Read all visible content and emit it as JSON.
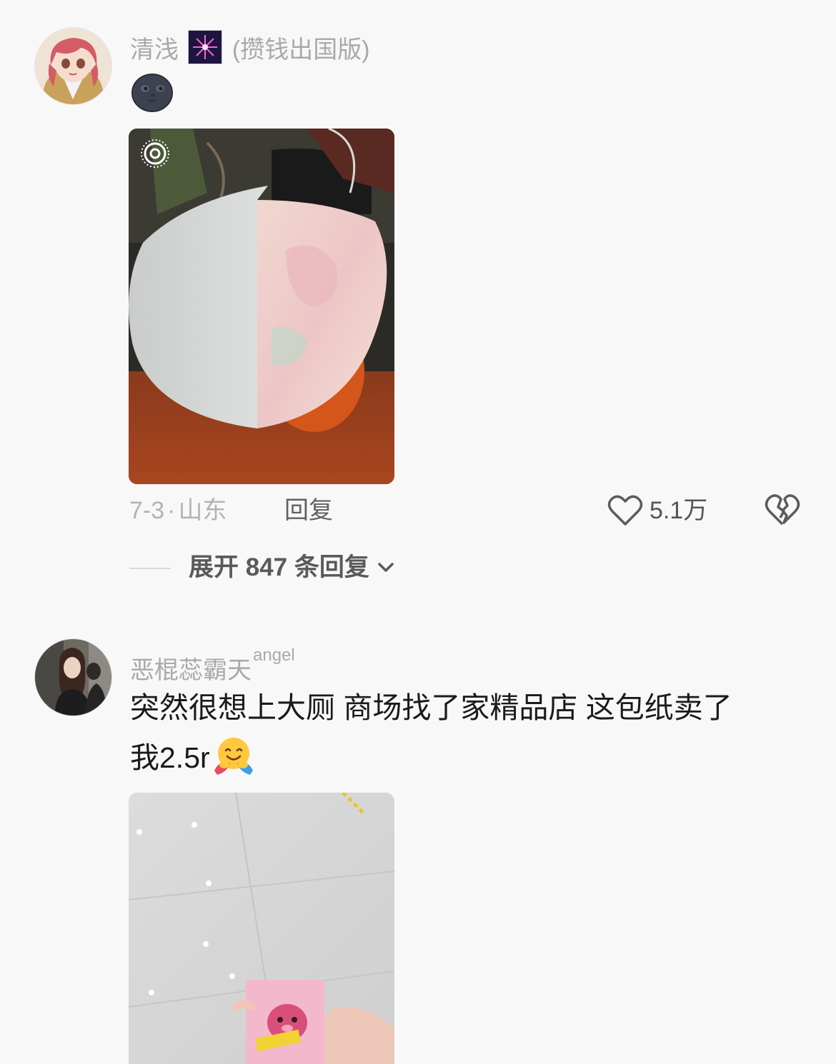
{
  "comments": [
    {
      "username": "清浅",
      "username_suffix": "(攒钱出国版)",
      "emoji_icon": "new-moon-face-emoji",
      "image_icon": "live-photo-icon",
      "date": "7-3",
      "separator": "·",
      "location": "山东",
      "reply_label": "回复",
      "like_count": "5.1万",
      "expand_label": "展开 847 条回复"
    },
    {
      "username": "恶棍蕊霸天",
      "username_sup": "angel",
      "text_line1": "突然很想上大厕 商场找了家精品店 这包纸卖了",
      "text_line2": "我2.5r",
      "emoji_icon": "hugging-face-emoji"
    }
  ],
  "colors": {
    "background": "#f8f8f8",
    "muted_text": "#a9a9a9",
    "primary_text": "#1a1a1a"
  }
}
